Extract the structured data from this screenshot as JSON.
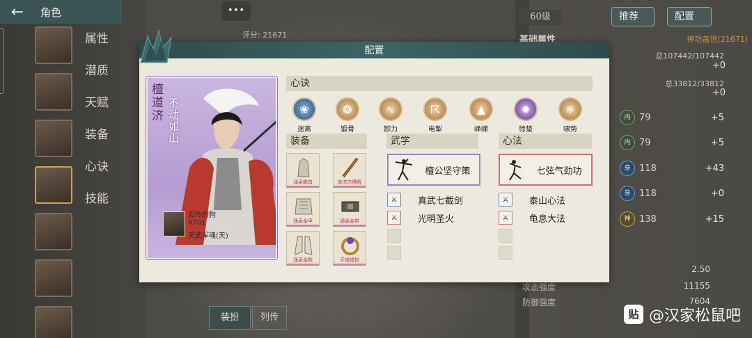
{
  "header": {
    "title": "角色"
  },
  "side_menu": [
    "属性",
    "潜质",
    "天赋",
    "装备",
    "心诀",
    "技能"
  ],
  "background": {
    "chat_icon": "•••",
    "score_label": "评分: 21671",
    "level": "60级",
    "recommend_btn": "推荐",
    "config_btn": "配置",
    "base_attr_title": "基础属性",
    "score_title": "神功盖世(21671)",
    "hp_total": "总107442/107442",
    "hp_plus": "+0",
    "mp_total": "总33812/33812",
    "mp_plus": "+0",
    "stats": [
      {
        "icon_text": "内",
        "value": "79",
        "plus": "+5",
        "color": "green"
      },
      {
        "icon_text": "内",
        "value": "79",
        "plus": "+5",
        "color": "green"
      },
      {
        "icon_text": "身",
        "value": "118",
        "plus": "+43",
        "color": "blue"
      },
      {
        "icon_text": "身",
        "value": "118",
        "plus": "+0",
        "color": "blue"
      },
      {
        "icon_text": "神",
        "value": "138",
        "plus": "+15",
        "color": "gold"
      }
    ],
    "crit_val": "2.50",
    "attack_label": "攻击强度",
    "attack_val": "11155",
    "defense_label": "防御强度",
    "defense_val": "7604",
    "equip_tab": "装扮",
    "list_tab": "列传"
  },
  "modal": {
    "title": "配置",
    "hero": {
      "name": "檀道济",
      "motto": "不动如山",
      "owner_name": "应怜的狗",
      "owner_score": "4701",
      "owner_title": "天武军魂(天)"
    },
    "xinjue": {
      "title": "心诀",
      "items": [
        {
          "label": "迷离",
          "icon": "swirl-icon",
          "color": "#5a86b8"
        },
        {
          "label": "锻骨",
          "icon": "bone-icon",
          "color": "#b88a4a"
        },
        {
          "label": "卸力",
          "icon": "wave-icon",
          "color": "#c99a48"
        },
        {
          "label": "电掣",
          "icon": "lightning-icon",
          "color": "#b78844"
        },
        {
          "label": "峥嵘",
          "icon": "peak-icon",
          "color": "#c19250"
        },
        {
          "label": "惊蛰",
          "icon": "thunder-icon",
          "color": "#7a5ab0"
        },
        {
          "label": "啸势",
          "icon": "roar-icon",
          "color": "#b5874a"
        }
      ]
    },
    "equip": {
      "title": "装备",
      "slots": [
        {
          "label": "涌泉瞻首"
        },
        {
          "label": "道济古佛棍"
        },
        {
          "label": "涌泉金甲"
        },
        {
          "label": "涌泉金带"
        },
        {
          "label": "涌泉金靴"
        },
        {
          "label": "天域戒指"
        }
      ]
    },
    "wuxue": {
      "title": "武学",
      "main": "檀公坚守策",
      "sub": [
        "真武七截剑",
        "光明圣火"
      ]
    },
    "xinfa": {
      "title": "心法",
      "main": "七弦气劲功",
      "sub": [
        "泰山心法",
        "龟息大法"
      ]
    }
  },
  "watermark": {
    "logo": "贴",
    "text": "@汉家松鼠吧"
  }
}
